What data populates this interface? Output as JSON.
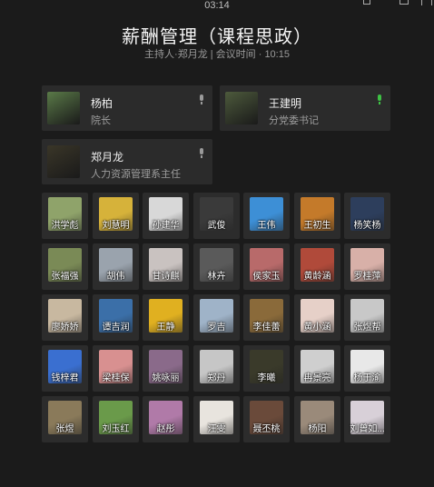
{
  "clock": "03:14",
  "meeting": {
    "title": "薪酬管理（课程思政）",
    "subtitle": "主持人·郑月龙 | 会议时间 · 10:15"
  },
  "hosts": [
    {
      "name": "杨柏",
      "role": "院长",
      "mic": "mic-icon",
      "mic_color": "#9a9a9a",
      "avatar_color": "#5a7a48"
    },
    {
      "name": "王建明",
      "role": "分党委书记",
      "mic": "mic-icon",
      "mic_color": "#3ec144",
      "avatar_color": "#4d5a3c"
    },
    {
      "name": "郑月龙",
      "role": "人力资源管理系主任",
      "mic": "mic-icon",
      "mic_color": "#9a9a9a",
      "avatar_color": "#3a3628"
    }
  ],
  "participants": [
    {
      "name": "洪学彪",
      "color": "#8fa36a"
    },
    {
      "name": "刘慧明",
      "color": "#d6b23a"
    },
    {
      "name": "孙建华",
      "color": "#d8d8d8"
    },
    {
      "name": "武俊",
      "color": "#3a3a3a"
    },
    {
      "name": "王伟",
      "color": "#3d8fd6"
    },
    {
      "name": "王初生",
      "color": "#c47a2a"
    },
    {
      "name": "杨笑杨",
      "color": "#2d3e5c"
    },
    {
      "name": "张福强",
      "color": "#7a8a56"
    },
    {
      "name": "胡伟",
      "color": "#9aa3ad"
    },
    {
      "name": "甘诗麒",
      "color": "#c9c2c0"
    },
    {
      "name": "林卉",
      "color": "#5a5a5a"
    },
    {
      "name": "侯家玉",
      "color": "#b86a6a"
    },
    {
      "name": "黄龄涵",
      "color": "#b04a3a"
    },
    {
      "name": "罗桂萍",
      "color": "#d8b0a8"
    },
    {
      "name": "廖娇娇",
      "color": "#c8b8a0"
    },
    {
      "name": "谭吉润",
      "color": "#3b6fa8"
    },
    {
      "name": "王静",
      "color": "#e0b020"
    },
    {
      "name": "罗吉",
      "color": "#9fb3c8"
    },
    {
      "name": "李佳蕾",
      "color": "#8a6a3a"
    },
    {
      "name": "黄小涵",
      "color": "#e6d0c8"
    },
    {
      "name": "张煜帮",
      "color": "#c8c8c8"
    },
    {
      "name": "钱梓君",
      "color": "#3a6fd0"
    },
    {
      "name": "梁桂保",
      "color": "#d89090"
    },
    {
      "name": "姚咏丽",
      "color": "#8a6a8a"
    },
    {
      "name": "郑丹",
      "color": "#c6c6c6"
    },
    {
      "name": "李曦",
      "color": "#3a3a2a"
    },
    {
      "name": "冉景亮",
      "color": "#cfcfcf"
    },
    {
      "name": "杨于渝",
      "color": "#e8e8e8"
    },
    {
      "name": "张煜",
      "color": "#8a7a5a"
    },
    {
      "name": "刘玉红",
      "color": "#6a9a4a"
    },
    {
      "name": "赵彤",
      "color": "#b07aa8"
    },
    {
      "name": "汪雯",
      "color": "#e8e4de"
    },
    {
      "name": "聂丕桃",
      "color": "#6a4a3a"
    },
    {
      "name": "杨阳",
      "color": "#9a8a7a"
    },
    {
      "name": "刘曾如...",
      "color": "#d8d0d8"
    }
  ]
}
